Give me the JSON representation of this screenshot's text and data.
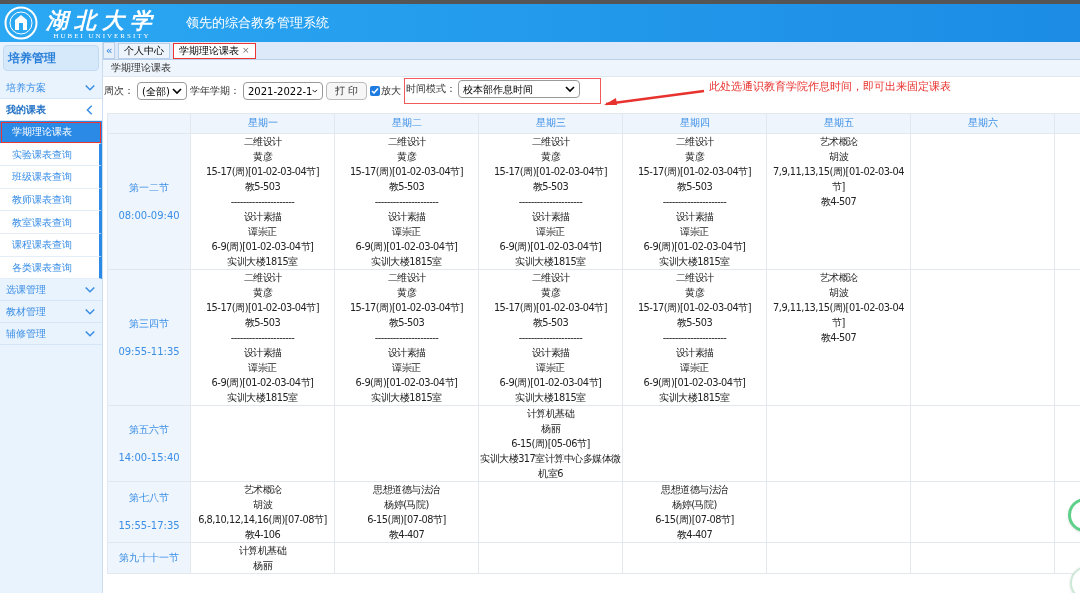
{
  "header": {
    "logo_text": "湖北大学",
    "logo_subtitle": "HUBEI UNIVERSITY",
    "system_title": "领先的综合教务管理系统"
  },
  "sidebar": {
    "title": "培养管理",
    "groups": [
      {
        "label": "培养方案",
        "expanded": false
      },
      {
        "label": "我的课表",
        "expanded": true,
        "children": [
          {
            "label": "学期理论课表",
            "selected": true
          },
          {
            "label": "实验课表查询",
            "selected": false
          },
          {
            "label": "班级课表查询",
            "selected": false
          },
          {
            "label": "教师课表查询",
            "selected": false
          },
          {
            "label": "教室课表查询",
            "selected": false
          },
          {
            "label": "课程课表查询",
            "selected": false
          },
          {
            "label": "各类课表查询",
            "selected": false
          }
        ]
      },
      {
        "label": "选课管理",
        "expanded": false
      },
      {
        "label": "教材管理",
        "expanded": false
      },
      {
        "label": "辅修管理",
        "expanded": false
      }
    ]
  },
  "tabs": {
    "collapse": "«",
    "items": [
      {
        "label": "个人中心",
        "selected": false
      },
      {
        "label": "学期理论课表",
        "selected": true,
        "close": "×"
      }
    ]
  },
  "panel_title": "学期理论课表",
  "toolbar": {
    "week_label": "周次：",
    "week_value": "(全部)",
    "term_label": "学年学期：",
    "term_value": "2021-2022-1",
    "print": "打 印",
    "zoom_label": "放大",
    "zoom_checked": true,
    "time_mode_label": "时间模式：",
    "time_mode_value": "校本部作息时间",
    "annotation": "此处选通识教育学院作息时间，即可出来固定课表"
  },
  "table": {
    "columns": [
      "星期一",
      "星期二",
      "星期三",
      "星期四",
      "星期五",
      "星期六"
    ],
    "rows": [
      {
        "period": "第一二节",
        "time": "08:00-09:40",
        "cells": [
          {
            "lines": [
              "二维设计",
              "黄彦",
              "15-17(周)[01-02-03-04节]",
              "教5-503",
              "---------------------",
              "设计素描",
              "谭崇正",
              "6-9(周)[01-02-03-04节]",
              "实训大楼1815室"
            ]
          },
          {
            "lines": [
              "二维设计",
              "黄彦",
              "15-17(周)[01-02-03-04节]",
              "教5-503",
              "---------------------",
              "设计素描",
              "谭崇正",
              "6-9(周)[01-02-03-04节]",
              "实训大楼1815室"
            ]
          },
          {
            "lines": [
              "二维设计",
              "黄彦",
              "15-17(周)[01-02-03-04节]",
              "教5-503",
              "---------------------",
              "设计素描",
              "谭崇正",
              "6-9(周)[01-02-03-04节]",
              "实训大楼1815室"
            ]
          },
          {
            "lines": [
              "二维设计",
              "黄彦",
              "15-17(周)[01-02-03-04节]",
              "教5-503",
              "---------------------",
              "设计素描",
              "谭崇正",
              "6-9(周)[01-02-03-04节]",
              "实训大楼1815室"
            ]
          },
          {
            "lines": [
              "艺术概论",
              "胡波",
              "7,9,11,13,15(周)[01-02-03-04节]",
              "教4-507"
            ]
          },
          {}
        ]
      },
      {
        "period": "第三四节",
        "time": "09:55-11:35",
        "cells": [
          {
            "lines": [
              "二维设计",
              "黄彦",
              "15-17(周)[01-02-03-04节]",
              "教5-503",
              "---------------------",
              "设计素描",
              "谭崇正",
              "6-9(周)[01-02-03-04节]",
              "实训大楼1815室"
            ]
          },
          {
            "lines": [
              "二维设计",
              "黄彦",
              "15-17(周)[01-02-03-04节]",
              "教5-503",
              "---------------------",
              "设计素描",
              "谭崇正",
              "6-9(周)[01-02-03-04节]",
              "实训大楼1815室"
            ]
          },
          {
            "lines": [
              "二维设计",
              "黄彦",
              "15-17(周)[01-02-03-04节]",
              "教5-503",
              "---------------------",
              "设计素描",
              "谭崇正",
              "6-9(周)[01-02-03-04节]",
              "实训大楼1815室"
            ]
          },
          {
            "lines": [
              "二维设计",
              "黄彦",
              "15-17(周)[01-02-03-04节]",
              "教5-503",
              "---------------------",
              "设计素描",
              "谭崇正",
              "6-9(周)[01-02-03-04节]",
              "实训大楼1815室"
            ]
          },
          {
            "lines": [
              "艺术概论",
              "胡波",
              "7,9,11,13,15(周)[01-02-03-04节]",
              "教4-507"
            ]
          },
          {}
        ]
      },
      {
        "period": "第五六节",
        "time": "14:00-15:40",
        "cells": [
          {},
          {},
          {
            "lines": [
              "计算机基础",
              "杨丽",
              "6-15(周)[05-06节]",
              "实训大楼317室计算中心多媒体微机室6"
            ]
          },
          {},
          {},
          {}
        ]
      },
      {
        "period": "第七八节",
        "time": "15:55-17:35",
        "cells": [
          {
            "lines": [
              "艺术概论",
              "胡波",
              "6,8,10,12,14,16(周)[07-08节]",
              "教4-106"
            ]
          },
          {
            "lines": [
              "思想道德与法治",
              "杨婷(马院)",
              "6-15(周)[07-08节]",
              "教4-407"
            ]
          },
          {},
          {
            "lines": [
              "思想道德与法治",
              "杨婷(马院)",
              "6-15(周)[07-08节]",
              "教4-407"
            ]
          },
          {},
          {}
        ]
      },
      {
        "period": "第九十十一节",
        "cells": [
          {
            "lines": [
              "计算机基础",
              "杨丽"
            ]
          },
          {},
          {},
          {},
          {},
          {}
        ]
      }
    ]
  }
}
